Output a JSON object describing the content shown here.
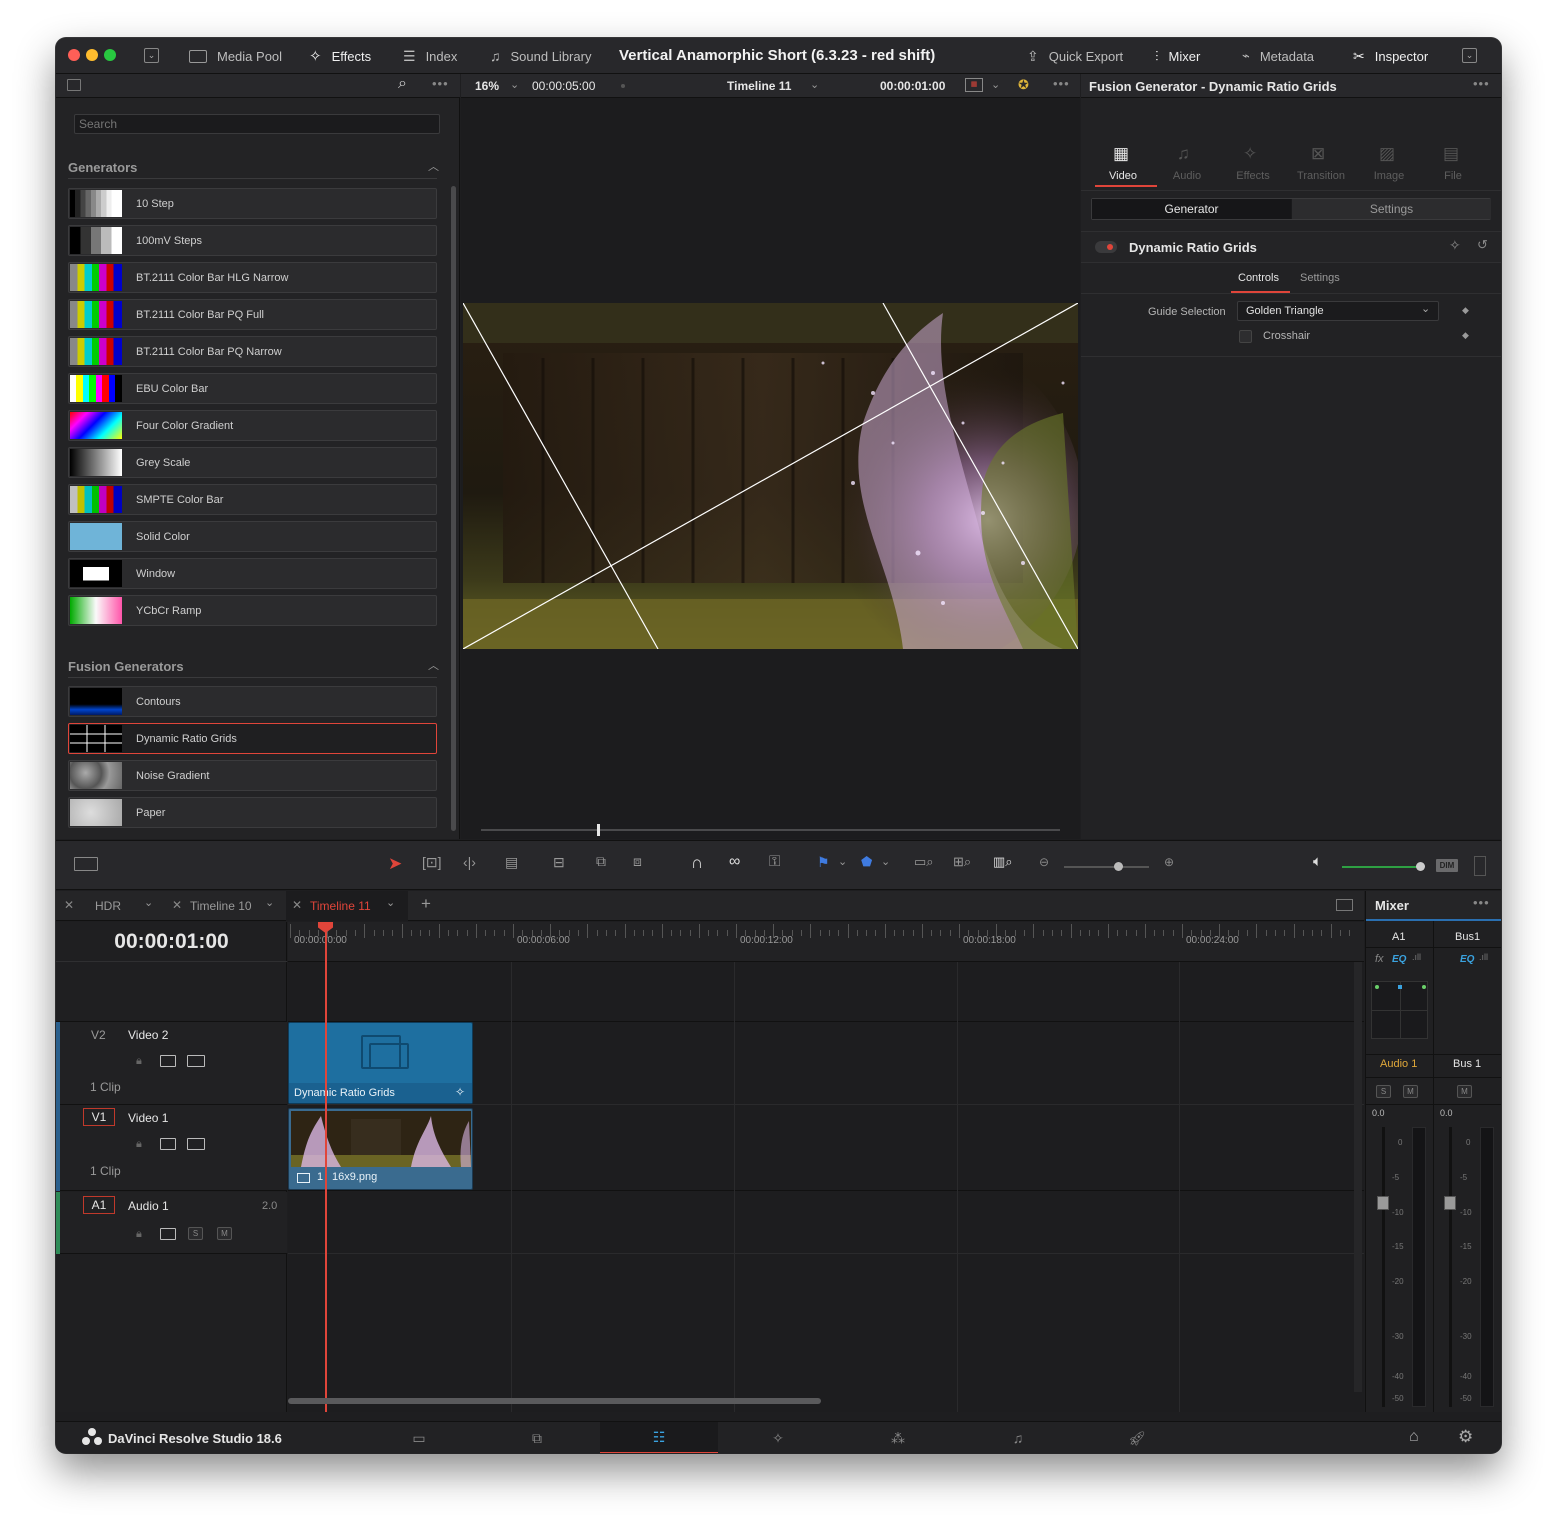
{
  "app": {
    "project_title": "Vertical Anamorphic Short (6.3.23 - red shift)",
    "brand": "DaVinci Resolve Studio 18.6"
  },
  "toolbar": {
    "left": [
      "Media Pool",
      "Effects",
      "Index",
      "Sound Library"
    ],
    "right": [
      "Quick Export",
      "Mixer",
      "Metadata",
      "Inspector"
    ]
  },
  "effects_panel": {
    "search_placeholder": "Search",
    "generators_title": "Generators",
    "generators": [
      "10 Step",
      "100mV Steps",
      "BT.2111 Color Bar HLG Narrow",
      "BT.2111 Color Bar PQ Full",
      "BT.2111 Color Bar PQ Narrow",
      "EBU Color Bar",
      "Four Color Gradient",
      "Grey Scale",
      "SMPTE Color Bar",
      "Solid Color",
      "Window",
      "YCbCr Ramp"
    ],
    "fusion_title": "Fusion Generators",
    "fusion_generators": [
      "Contours",
      "Dynamic Ratio Grids",
      "Noise Gradient",
      "Paper"
    ],
    "selected": "Dynamic Ratio Grids"
  },
  "viewer": {
    "zoom": "16%",
    "duration": "00:00:05:00",
    "timeline_name": "Timeline 11",
    "timecode": "00:00:01:00"
  },
  "inspector": {
    "title": "Fusion Generator - Dynamic Ratio Grids",
    "tabs": [
      "Video",
      "Audio",
      "Effects",
      "Transition",
      "Image",
      "File"
    ],
    "active_tab": "Video",
    "subtabs": [
      "Generator",
      "Settings"
    ],
    "node_name": "Dynamic Ratio Grids",
    "control_tabs": [
      "Controls",
      "Settings"
    ],
    "guide_selection_label": "Guide Selection",
    "guide_selection_value": "Golden Triangle",
    "crosshair_label": "Crosshair"
  },
  "timeline": {
    "tabs": [
      "HDR",
      "Timeline 10",
      "Timeline 11"
    ],
    "active_tab": "Timeline 11",
    "timecode": "00:00:01:00",
    "ruler": [
      "00:00:00:00",
      "00:00:06:00",
      "00:00:12:00",
      "00:00:18:00",
      "00:00:24:00"
    ],
    "tracks": [
      {
        "id": "V2",
        "name": "Video 2",
        "clips": "1 Clip"
      },
      {
        "id": "V1",
        "name": "Video 1",
        "clips": "1 Clip"
      },
      {
        "id": "A1",
        "name": "Audio 1",
        "channels": "2.0"
      }
    ],
    "clip_v2": "Dynamic Ratio Grids",
    "clip_v1": "16x9.png",
    "clip_v1_prefix": "1"
  },
  "mixer": {
    "title": "Mixer",
    "channels": [
      "A1",
      "Bus1"
    ],
    "channel_names": [
      "Audio 1",
      "Bus 1"
    ],
    "levels": [
      "0.0",
      "0.0"
    ],
    "scale": [
      "0",
      "-5",
      "-10",
      "-15",
      "-20",
      "-30",
      "-40",
      "-50"
    ],
    "eq": "EQ",
    "fx": "fx",
    "s": "S",
    "m": "M",
    "dim": "DIM"
  },
  "colors": {
    "accent": "#e0453a",
    "clip_blue": "#1e6fa0",
    "clip_v1": "#3a6b8f"
  }
}
